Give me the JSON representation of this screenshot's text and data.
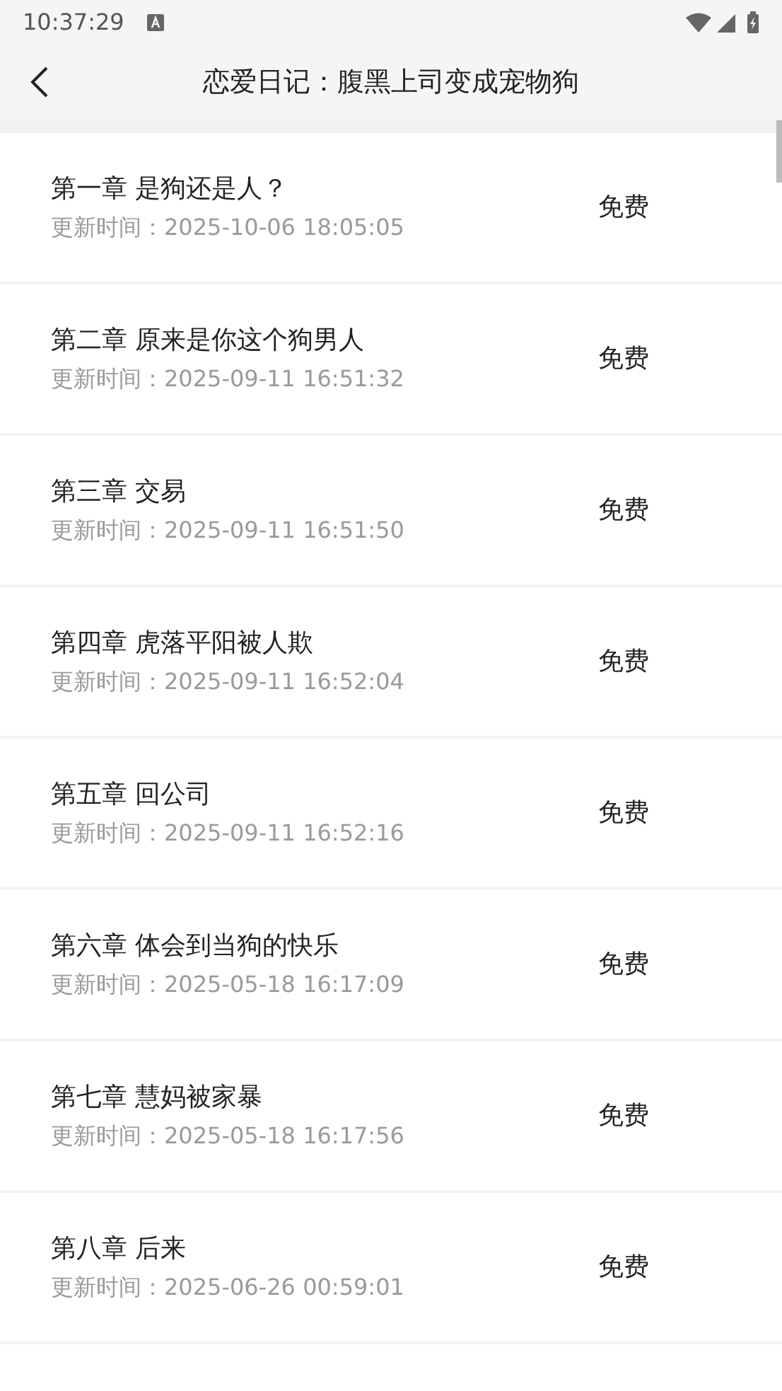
{
  "status_bar": {
    "time": "10:37:29"
  },
  "header": {
    "title": "恋爱日记：腹黑上司变成宠物狗"
  },
  "chapters": [
    {
      "title": "第一章 是狗还是人？",
      "updated": "更新时间：2025-10-06 18:05:05",
      "price": "免费"
    },
    {
      "title": "第二章 原来是你这个狗男人",
      "updated": "更新时间：2025-09-11 16:51:32",
      "price": "免费"
    },
    {
      "title": "第三章 交易",
      "updated": "更新时间：2025-09-11 16:51:50",
      "price": "免费"
    },
    {
      "title": "第四章 虎落平阳被人欺",
      "updated": "更新时间：2025-09-11 16:52:04",
      "price": "免费"
    },
    {
      "title": "第五章 回公司",
      "updated": "更新时间：2025-09-11 16:52:16",
      "price": "免费"
    },
    {
      "title": "第六章 体会到当狗的快乐",
      "updated": "更新时间：2025-05-18 16:17:09",
      "price": "免费"
    },
    {
      "title": "第七章 慧妈被家暴",
      "updated": "更新时间：2025-05-18 16:17:56",
      "price": "免费"
    },
    {
      "title": "第八章 后来",
      "updated": "更新时间：2025-06-26 00:59:01",
      "price": "免费"
    }
  ]
}
